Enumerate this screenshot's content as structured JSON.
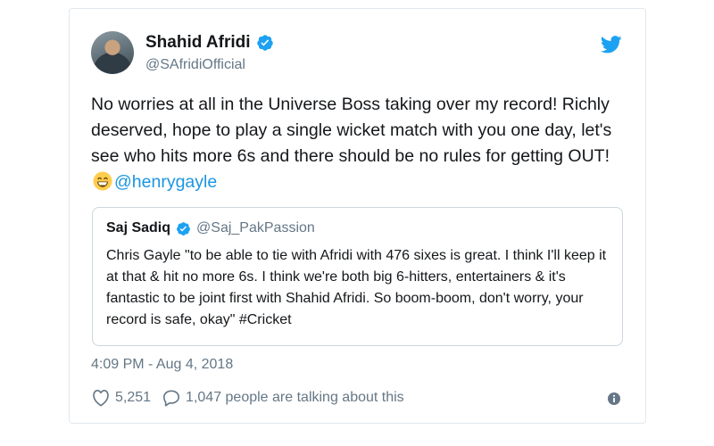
{
  "author": {
    "display_name": "Shahid Afridi",
    "handle": "@SAfridiOfficial",
    "avatar_icon": "profile-photo",
    "verified_icon": "verified-badge-icon"
  },
  "tweet": {
    "text": "No worries at all in the Universe Boss taking over my record! Richly deserved, hope to play a single wicket match with you one day, let's see who hits more 6s and there should be no rules for getting OUT! ",
    "emoji": "grinning-face-emoji",
    "mention": "@henrygayle"
  },
  "quote": {
    "display_name": "Saj Sadiq",
    "handle": "@Saj_PakPassion",
    "text": "Chris Gayle \"to be able to tie with Afridi with 476 sixes is great. I think I'll keep it at that & hit no more 6s. I think we're both big 6-hitters, entertainers & it's fantastic to be joint first with Shahid Afridi. So boom-boom, don't worry, your record is safe, okay\" #Cricket"
  },
  "meta": {
    "timestamp": "4:09 PM - Aug 4, 2018",
    "likes": "5,251",
    "replies_text": "1,047 people are talking about this"
  },
  "colors": {
    "brand_blue": "#1da1f2",
    "link_blue": "#1b95e0",
    "muted_gray": "#657786",
    "border": "#e1e8ed"
  }
}
